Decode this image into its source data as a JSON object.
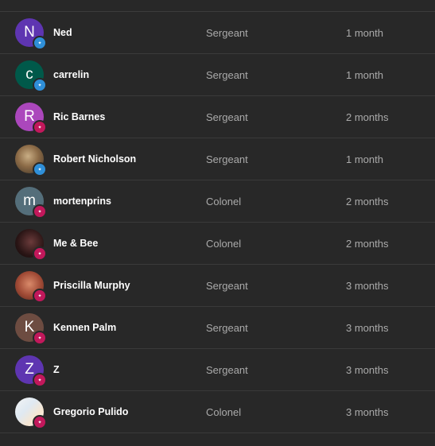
{
  "members": [
    {
      "initial": "N",
      "name": "Ned",
      "rank": "Sergeant",
      "tenure": "1 month",
      "avatar_color": "#5e35b1",
      "badge": "seg"
    },
    {
      "initial": "c",
      "name": "carrelin",
      "rank": "Sergeant",
      "tenure": "1 month",
      "avatar_color": "#00594a",
      "badge": "seg"
    },
    {
      "initial": "R",
      "name": "Ric Barnes",
      "rank": "Sergeant",
      "tenure": "2 months",
      "avatar_color": "#ab47bc",
      "badge": "col"
    },
    {
      "initial": "",
      "name": "Robert Nicholson",
      "rank": "Sergeant",
      "tenure": "1 month",
      "avatar_color": "",
      "badge": "seg",
      "photo": "p-dog"
    },
    {
      "initial": "m",
      "name": "mortenprins",
      "rank": "Colonel",
      "tenure": "2 months",
      "avatar_color": "#546e7a",
      "badge": "col"
    },
    {
      "initial": "",
      "name": "Me & Bee",
      "rank": "Colonel",
      "tenure": "2 months",
      "avatar_color": "",
      "badge": "col",
      "photo": "p-bee"
    },
    {
      "initial": "",
      "name": "Priscilla Murphy",
      "rank": "Sergeant",
      "tenure": "3 months",
      "avatar_color": "",
      "badge": "col",
      "photo": "p-pris"
    },
    {
      "initial": "K",
      "name": "Kennen Palm",
      "rank": "Sergeant",
      "tenure": "3 months",
      "avatar_color": "#6d4c41",
      "badge": "col"
    },
    {
      "initial": "Z",
      "name": "Z",
      "rank": "Sergeant",
      "tenure": "3 months",
      "avatar_color": "#5e35b1",
      "badge": "col"
    },
    {
      "initial": "",
      "name": "Gregorio Pulido",
      "rank": "Colonel",
      "tenure": "3 months",
      "avatar_color": "",
      "badge": "col",
      "photo": "p-greg"
    }
  ]
}
